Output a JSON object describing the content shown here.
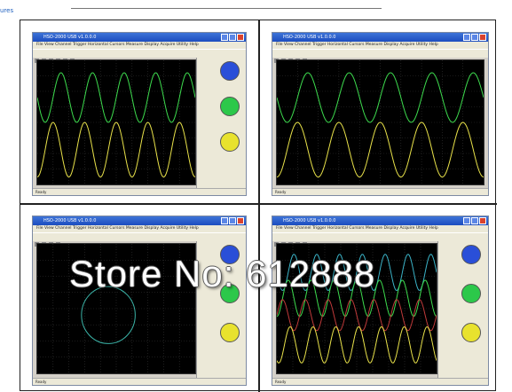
{
  "page": {
    "tab_fragment": "ures",
    "watermark": "Store No: 612888"
  },
  "screens": [
    {
      "title": "HSO-2000 USB v1.0.0.0",
      "menu": "File  View  Channel  Trigger  Horizontal  Cursors  Measure  Display  Acquire  Utility  Help",
      "status": "Ready",
      "mode": "dual-sine",
      "colors": {
        "ch1": "#3ddc4e",
        "ch2": "#e9e24a"
      },
      "knobs": [
        "#2a4fd8",
        "#2cc84a",
        "#e8e22e"
      ]
    },
    {
      "title": "HSO-2000 USB v1.0.0.0",
      "menu": "File  View  Channel  Trigger  Horizontal  Cursors  Measure  Display  Acquire  Utility  Help",
      "status": "Ready",
      "mode": "dual-sine-full",
      "colors": {
        "ch1": "#3ddc4e",
        "ch2": "#e9e24a"
      },
      "knobs": []
    },
    {
      "title": "HSO-2000 USB v1.0.0.0",
      "menu": "File  View  Channel  Trigger  Horizontal  Cursors  Measure  Display  Acquire  Utility  Help",
      "status": "Ready",
      "mode": "xy-circle",
      "colors": {
        "ch1": "#3bb4a8",
        "ch2": "#e9e24a"
      },
      "knobs": [
        "#2a4fd8",
        "#2cc84a",
        "#e8e22e"
      ]
    },
    {
      "title": "HSO-2000 USB v1.0.0.0",
      "menu": "File  View  Channel  Trigger  Horizontal  Cursors  Measure  Display  Acquire  Utility  Help",
      "status": "Ready",
      "mode": "quad-sine",
      "colors": {
        "ch1": "#3bb4c8",
        "ch2": "#c03a3a",
        "ch3": "#3ddc4e",
        "ch4": "#e9e24a"
      },
      "knobs": [
        "#2a4fd8",
        "#2cc84a",
        "#e8e22e"
      ]
    }
  ]
}
